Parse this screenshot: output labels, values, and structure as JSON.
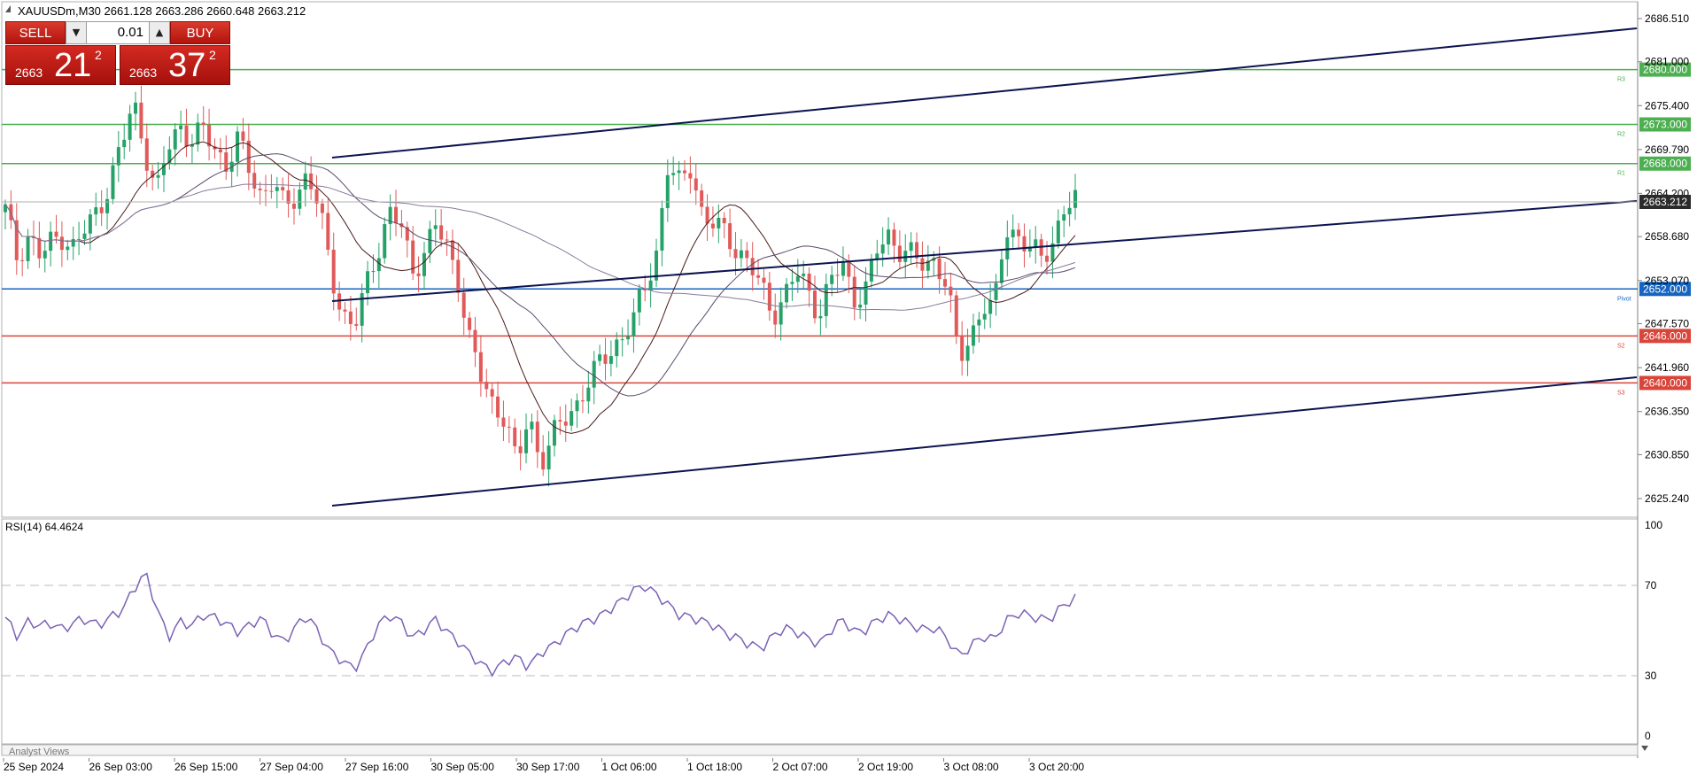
{
  "chart": {
    "header": "XAUUSDm,M30  2661.128 2663.286 2660.648 2663.212",
    "symbol": "XAUUSDm",
    "timeframe": "M30",
    "bid_tag": "2663.212",
    "footer_tab": "Analyst Views"
  },
  "trade_panel": {
    "sell_label": "SELL",
    "buy_label": "BUY",
    "lot_value": "0.01",
    "sell_price_big": "2663",
    "sell_price_pips": "21",
    "sell_price_sup": "2",
    "buy_price_big": "2663",
    "buy_price_pips": "37",
    "buy_price_sup": "2"
  },
  "rsi": {
    "label": "RSI(14) 64.4624",
    "levels": [
      "100",
      "70",
      "30",
      "0"
    ]
  },
  "colors": {
    "bull": "#26a269",
    "bear": "#e05a5a",
    "resistance": "#4caf50",
    "support": "#d9453a",
    "pivot": "#1565c0",
    "channel": "#0c1450",
    "rsi_line": "#7b62b5"
  },
  "chart_data": {
    "type": "candlestick",
    "price_ticks": [
      "2686.510",
      "2681.000",
      "2675.400",
      "2669.790",
      "2664.200",
      "2658.680",
      "2653.070",
      "2647.570",
      "2641.960",
      "2636.350",
      "2630.850",
      "2625.240"
    ],
    "time_labels": [
      "25 Sep 2024",
      "26 Sep 03:00",
      "26 Sep 15:00",
      "27 Sep 04:00",
      "27 Sep 16:00",
      "30 Sep 05:00",
      "30 Sep 17:00",
      "1 Oct 06:00",
      "1 Oct 18:00",
      "2 Oct 07:00",
      "2 Oct 19:00",
      "3 Oct 08:00",
      "3 Oct 20:00"
    ],
    "levels": [
      {
        "name": "R3",
        "value": 2680.0,
        "label": "2680.000",
        "kind": "resistance"
      },
      {
        "name": "R2",
        "value": 2673.0,
        "label": "2673.000",
        "kind": "resistance"
      },
      {
        "name": "R1",
        "value": 2668.0,
        "label": "2668.000",
        "kind": "resistance"
      },
      {
        "name": "Pivot",
        "value": 2652.0,
        "label": "2652.000",
        "kind": "pivot"
      },
      {
        "name": "S2",
        "value": 2646.0,
        "label": "2646.000",
        "kind": "support"
      },
      {
        "name": "S3",
        "value": 2640.0,
        "label": "2640.000",
        "kind": "support"
      }
    ],
    "current_price": 2663.212,
    "close_path": [
      2662,
      2656,
      2659,
      2656,
      2658,
      2659,
      2657,
      2660,
      2662,
      2666,
      2670,
      2676,
      2670,
      2664,
      2670,
      2673,
      2671,
      2672,
      2670,
      2668,
      2671,
      2667,
      2664,
      2666,
      2662,
      2664,
      2667,
      2662,
      2654,
      2649,
      2647,
      2652,
      2657,
      2662,
      2660,
      2654,
      2657,
      2660,
      2657,
      2653,
      2645,
      2640,
      2637,
      2636,
      2629,
      2636,
      2630,
      2633,
      2635,
      2637,
      2640,
      2642,
      2644,
      2646,
      2648,
      2652,
      2657,
      2668,
      2665,
      2668,
      2661,
      2660,
      2659,
      2657,
      2655,
      2652,
      2649,
      2651,
      2654,
      2652,
      2649,
      2653,
      2655,
      2651,
      2652,
      2657,
      2659,
      2657,
      2656,
      2655,
      2656,
      2652,
      2643,
      2646,
      2650,
      2649,
      2660,
      2659,
      2657,
      2656,
      2658,
      2662,
      2663
    ],
    "rsi_path": [
      57,
      48,
      55,
      53,
      54,
      51,
      55,
      56,
      53,
      57,
      60,
      70,
      79,
      62,
      47,
      55,
      53,
      58,
      57,
      54,
      50,
      53,
      57,
      49,
      45,
      53,
      58,
      49,
      40,
      36,
      32,
      41,
      53,
      58,
      55,
      47,
      51,
      56,
      50,
      45,
      39,
      34,
      31,
      36,
      38,
      33,
      40,
      43,
      48,
      52,
      55,
      57,
      61,
      65,
      70,
      72,
      68,
      63,
      58,
      57,
      55,
      53,
      49,
      47,
      44,
      42,
      48,
      52,
      50,
      47,
      44,
      51,
      56,
      50,
      51,
      56,
      58,
      56,
      53,
      51,
      52,
      47,
      38,
      43,
      48,
      46,
      55,
      59,
      58,
      56,
      57,
      63,
      66
    ]
  }
}
